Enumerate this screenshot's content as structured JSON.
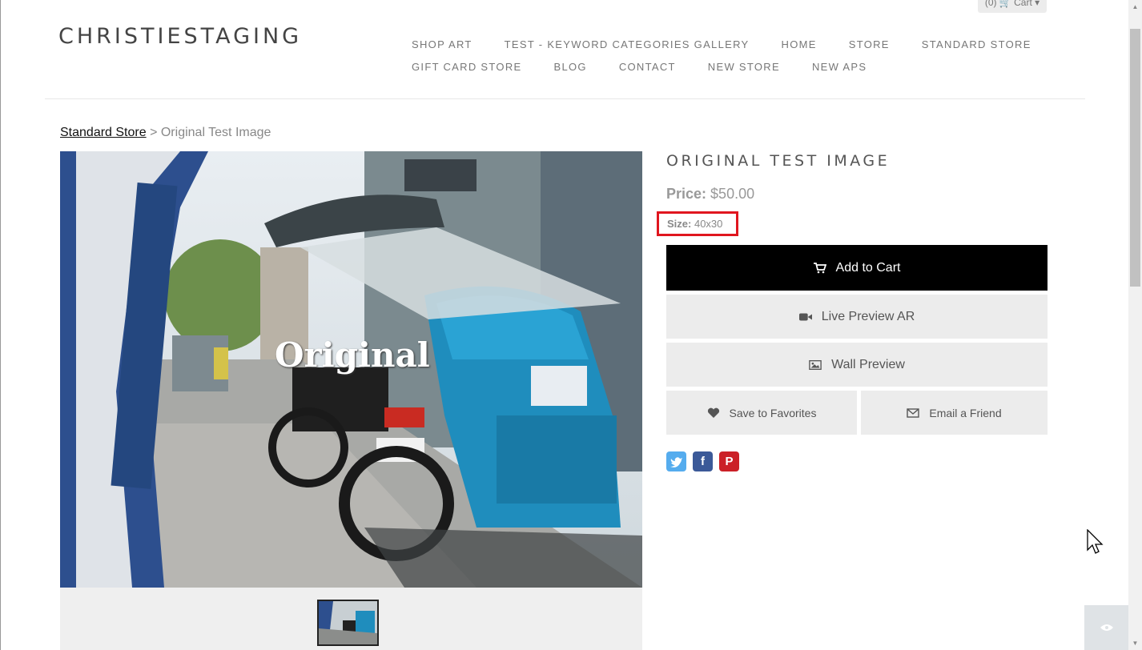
{
  "site": {
    "title": "CHRISTIESTAGING",
    "cart_label": "(0) 🛒 Cart ▾"
  },
  "nav": {
    "row1": [
      "SHOP ART",
      "TEST - KEYWORD CATEGORIES GALLERY",
      "HOME",
      "STORE",
      "STANDARD STORE"
    ],
    "row2": [
      "GIFT CARD STORE",
      "BLOG",
      "CONTACT",
      "NEW STORE",
      "NEW APS"
    ]
  },
  "breadcrumb": {
    "parent": "Standard Store",
    "separator": " > ",
    "current": "Original Test Image"
  },
  "image": {
    "watermark": "Original"
  },
  "product": {
    "title": "ORIGINAL TEST IMAGE",
    "price_label": "Price:",
    "price_value": "$50.00",
    "size_label": "Size:",
    "size_value": "40x30"
  },
  "buttons": {
    "add_to_cart": "Add to Cart",
    "live_preview": "Live Preview AR",
    "wall_preview": "Wall Preview",
    "save_favorites": "Save to Favorites",
    "email_friend": "Email a Friend"
  },
  "social": {
    "twitter": "t",
    "facebook": "f",
    "pinterest": "P"
  },
  "colors": {
    "accent_red": "#e0161f",
    "cart_button": "#000000",
    "gray_button": "#ececec",
    "twitter": "#55acee",
    "facebook": "#3b5998",
    "pinterest": "#cb2027"
  }
}
